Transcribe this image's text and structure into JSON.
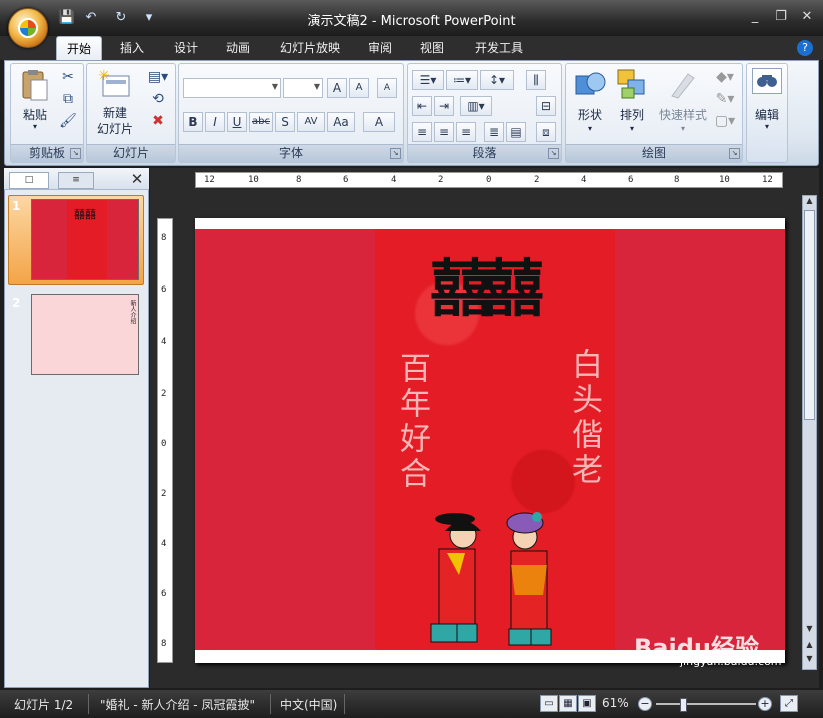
{
  "window": {
    "title": "演示文稿2 - Microsoft PowerPoint",
    "minimize": "_",
    "restore": "❐",
    "close": "✕"
  },
  "qat": {
    "save": "💾",
    "undo": "↶",
    "redo": "↻",
    "customize": "▾"
  },
  "tabs": [
    "开始",
    "插入",
    "设计",
    "动画",
    "幻灯片放映",
    "审阅",
    "视图",
    "开发工具"
  ],
  "help": "?",
  "ribbon": {
    "clipboard": {
      "label": "剪贴板",
      "paste": "粘贴"
    },
    "slides": {
      "label": "幻灯片",
      "new_slide_line1": "新建",
      "new_slide_line2": "幻灯片"
    },
    "font": {
      "label": "字体",
      "bold": "B",
      "italic": "I",
      "underline": "U",
      "strike": "abc",
      "shadow": "S",
      "spacing": "AV",
      "case": "Aa",
      "color": "A",
      "grow": "A",
      "shrink": "A",
      "clear": "A"
    },
    "paragraph": {
      "label": "段落"
    },
    "drawing": {
      "label": "绘图",
      "shapes": "形状",
      "arrange": "排列",
      "quick_styles": "快速样式"
    },
    "editing": {
      "label": "编辑"
    }
  },
  "left_panel": {
    "tab_slides": "□",
    "tab_outline": "≡",
    "close": "✕",
    "thumbs": [
      {
        "num": "1"
      },
      {
        "num": "2"
      }
    ]
  },
  "ruler": {
    "h_labels": [
      "12",
      "10",
      "8",
      "6",
      "4",
      "2",
      "0",
      "2",
      "4",
      "6",
      "8",
      "10",
      "12"
    ],
    "v_labels": [
      "8",
      "6",
      "4",
      "2",
      "0",
      "2",
      "4",
      "6",
      "8"
    ]
  },
  "slide": {
    "xi": "囍囍",
    "left_text": "百年好合",
    "right_text": "白头偕老"
  },
  "thumb2_text": "新人介绍",
  "status": {
    "slide_pos": "幻灯片 1/2",
    "theme": "\"婚礼 - 新人介绍 - 凤冠霞披\"",
    "language": "中文(中国)",
    "zoom": "61%"
  },
  "watermark": {
    "brand": "Baidu经验",
    "url": "jingyan.baidu.com"
  },
  "colors": {
    "slide_red": "#d9253b",
    "card_red": "#e41c25",
    "accent_orange": "#f3a447"
  }
}
